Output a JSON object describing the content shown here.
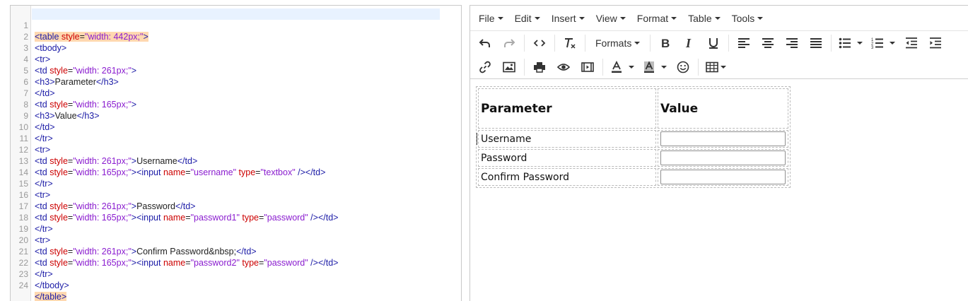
{
  "code_editor": {
    "line_numbers": [
      "1",
      "2",
      "3",
      "4",
      "5",
      "6",
      "7",
      "8",
      "9",
      "10",
      "11",
      "12",
      "13",
      "14",
      "15",
      "16",
      "17",
      "18",
      "19",
      "20",
      "21",
      "22",
      "23",
      "24"
    ],
    "l1": {
      "open": "<table ",
      "attr": "style",
      "eq": "=",
      "val": "\"width: 442px;\"",
      "close": ">"
    },
    "l2": "<tbody>",
    "l3": "<tr>",
    "l4": {
      "open": "<td ",
      "attr": "style",
      "eq": "=",
      "val": "\"width: 261px;\"",
      "close": ">"
    },
    "l5": {
      "open": "<h3>",
      "text": "Parameter",
      "close": "</h3>"
    },
    "l6": "</td>",
    "l7": {
      "open": "<td ",
      "attr": "style",
      "eq": "=",
      "val": "\"width: 165px;\"",
      "close": ">"
    },
    "l8": {
      "open": "<h3>",
      "text": "Value",
      "close": "</h3>"
    },
    "l9": "</td>",
    "l10": "</tr>",
    "l11": "<tr>",
    "l12": {
      "open": "<td ",
      "attr": "style",
      "eq": "=",
      "val": "\"width: 261px;\"",
      "close": ">",
      "text": "Username",
      "end": "</td>"
    },
    "l13": {
      "open": "<td ",
      "attr": "style",
      "eq": "=",
      "val": "\"width: 165px;\"",
      "close": ">",
      "i_open": "<input ",
      "a1": "name",
      "v1": "\"username\"",
      "a2": "type",
      "v2": "\"textbox\"",
      "i_close": " /></td>"
    },
    "l14": "</tr>",
    "l15": "<tr>",
    "l16": {
      "open": "<td ",
      "attr": "style",
      "eq": "=",
      "val": "\"width: 261px;\"",
      "close": ">",
      "text": "Password",
      "end": "</td>"
    },
    "l17": {
      "open": "<td ",
      "attr": "style",
      "eq": "=",
      "val": "\"width: 165px;\"",
      "close": ">",
      "i_open": "<input ",
      "a1": "name",
      "v1": "\"password1\"",
      "a2": "type",
      "v2": "\"password\"",
      "i_close": " /></td>"
    },
    "l18": "</tr>",
    "l19": "<tr>",
    "l20": {
      "open": "<td ",
      "attr": "style",
      "eq": "=",
      "val": "\"width: 261px;\"",
      "close": ">",
      "text": "Confirm Password&nbsp;",
      "end": "</td>"
    },
    "l21": {
      "open": "<td ",
      "attr": "style",
      "eq": "=",
      "val": "\"width: 165px;\"",
      "close": ">",
      "i_open": "<input ",
      "a1": "name",
      "v1": "\"password2\"",
      "a2": "type",
      "v2": "\"password\"",
      "i_close": " /></td>"
    },
    "l22": "</tr>",
    "l23": "</tbody>",
    "l24": "</table>"
  },
  "menubar": {
    "file": "File",
    "edit": "Edit",
    "insert": "Insert",
    "view": "View",
    "format": "Format",
    "table": "Table",
    "tools": "Tools"
  },
  "toolbar": {
    "formats_label": "Formats",
    "icons": [
      "undo-icon",
      "redo-icon",
      "source-code-icon",
      "clear-format-icon",
      "bold-icon",
      "italic-icon",
      "underline-icon",
      "align-left-icon",
      "align-center-icon",
      "align-right-icon",
      "justify-icon",
      "bullet-list-icon",
      "numbered-list-icon",
      "outdent-icon",
      "indent-icon",
      "link-icon",
      "image-icon",
      "print-icon",
      "preview-icon",
      "media-icon",
      "text-color-icon",
      "background-color-icon",
      "emoticons-icon",
      "table-icon"
    ]
  },
  "preview_table": {
    "header_param": "Parameter",
    "header_value": "Value",
    "rows": [
      {
        "label": "Username"
      },
      {
        "label": "Password"
      },
      {
        "label": "Confirm Password"
      }
    ]
  },
  "colors": {
    "tag": "#1a1aa6",
    "attribute": "#cc0000",
    "value": "#8a1ccf",
    "match_highlight": "#ffd8b0",
    "active_line": "#e8f2ff"
  }
}
